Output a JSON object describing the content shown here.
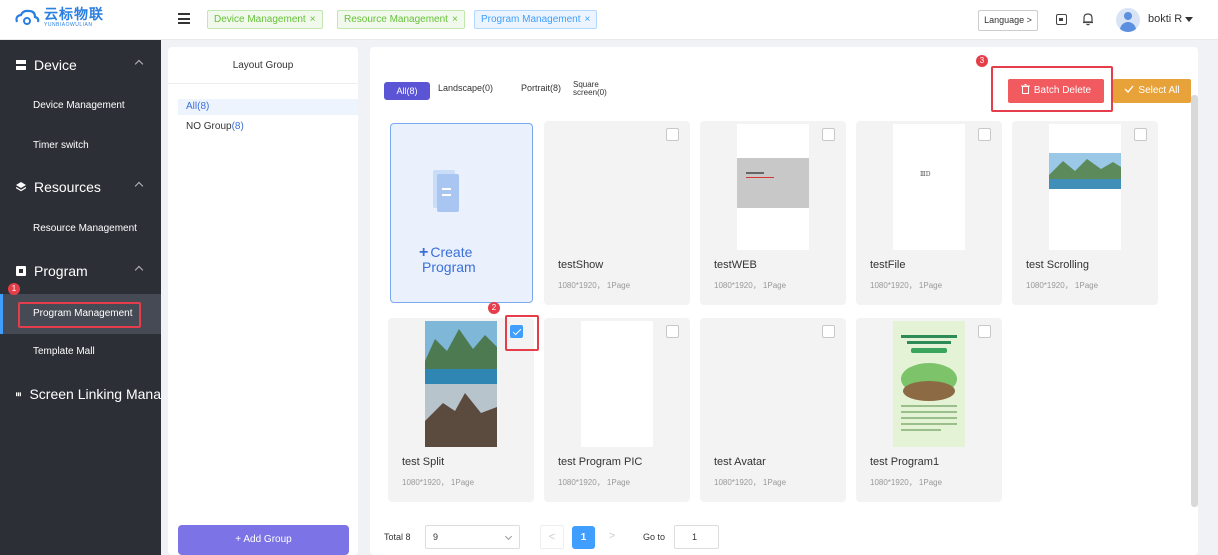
{
  "header": {
    "logo_cn": "云标物联",
    "logo_en": "YUNBIAOWULIAN",
    "tabs": [
      {
        "label": "Device Management",
        "close": "×"
      },
      {
        "label": "Resource Management",
        "close": "×"
      },
      {
        "label": "Program Management",
        "close": "×"
      }
    ],
    "language_label": "Language >",
    "username": "bokti R"
  },
  "sidebar": {
    "groups": [
      {
        "label": "Device",
        "items": [
          "Device Management",
          "Timer switch"
        ]
      },
      {
        "label": "Resources",
        "items": [
          "Resource Management"
        ]
      },
      {
        "label": "Program",
        "items": [
          "Program Management",
          "Template Mall"
        ]
      },
      {
        "label": "Screen Linking Mana",
        "items": []
      }
    ],
    "active_item": "Program Management"
  },
  "layout_group": {
    "title": "Layout Group",
    "rows": [
      {
        "label": "All(8)"
      },
      {
        "label": "NO Group",
        "count": "(8)"
      }
    ],
    "add_button": "+ Add Group"
  },
  "filters": {
    "tabs": [
      "All(8)",
      "Landscape(0)",
      "Portrait(8)"
    ],
    "square_line1": "Square",
    "square_line2": "screen(0)",
    "active": "All(8)"
  },
  "actions": {
    "batch_delete": "Batch Delete",
    "select_all": "Select All"
  },
  "create_card": {
    "line1": "Create",
    "line2": "Program",
    "plus": "+"
  },
  "programs": [
    {
      "name": "testShow",
      "meta": "1080*1920， 1Page",
      "checked": false
    },
    {
      "name": "testWEB",
      "meta": "1080*1920， 1Page",
      "checked": false
    },
    {
      "name": "testFile",
      "meta": "1080*1920， 1Page",
      "checked": false
    },
    {
      "name": "test Scrolling",
      "meta": "1080*1920， 1Page",
      "checked": false
    },
    {
      "name": "test Split",
      "meta": "1080*1920， 1Page",
      "checked": true
    },
    {
      "name": "test Program PIC",
      "meta": "1080*1920， 1Page",
      "checked": false
    },
    {
      "name": "test Avatar",
      "meta": "1080*1920， 1Page",
      "checked": false
    },
    {
      "name": "test Program1",
      "meta": "1080*1920， 1Page",
      "checked": false
    }
  ],
  "thumb_text": {
    "testfile": "ⅢⅮ"
  },
  "pagination": {
    "total": "Total 8",
    "page_size": "9",
    "current": "1",
    "goto_label": "Go to",
    "goto_value": "1",
    "prev": "<",
    "next": ">"
  },
  "annotations": {
    "step1": "1",
    "step2": "2",
    "step3": "3"
  },
  "colors": {
    "sidebar_bg": "#2c2f36",
    "accent_blue": "#409eff",
    "filter_purple": "#5b55d6",
    "danger": "#f15a5e",
    "warning": "#e8a23a",
    "annotation_red": "#e53e4a"
  }
}
